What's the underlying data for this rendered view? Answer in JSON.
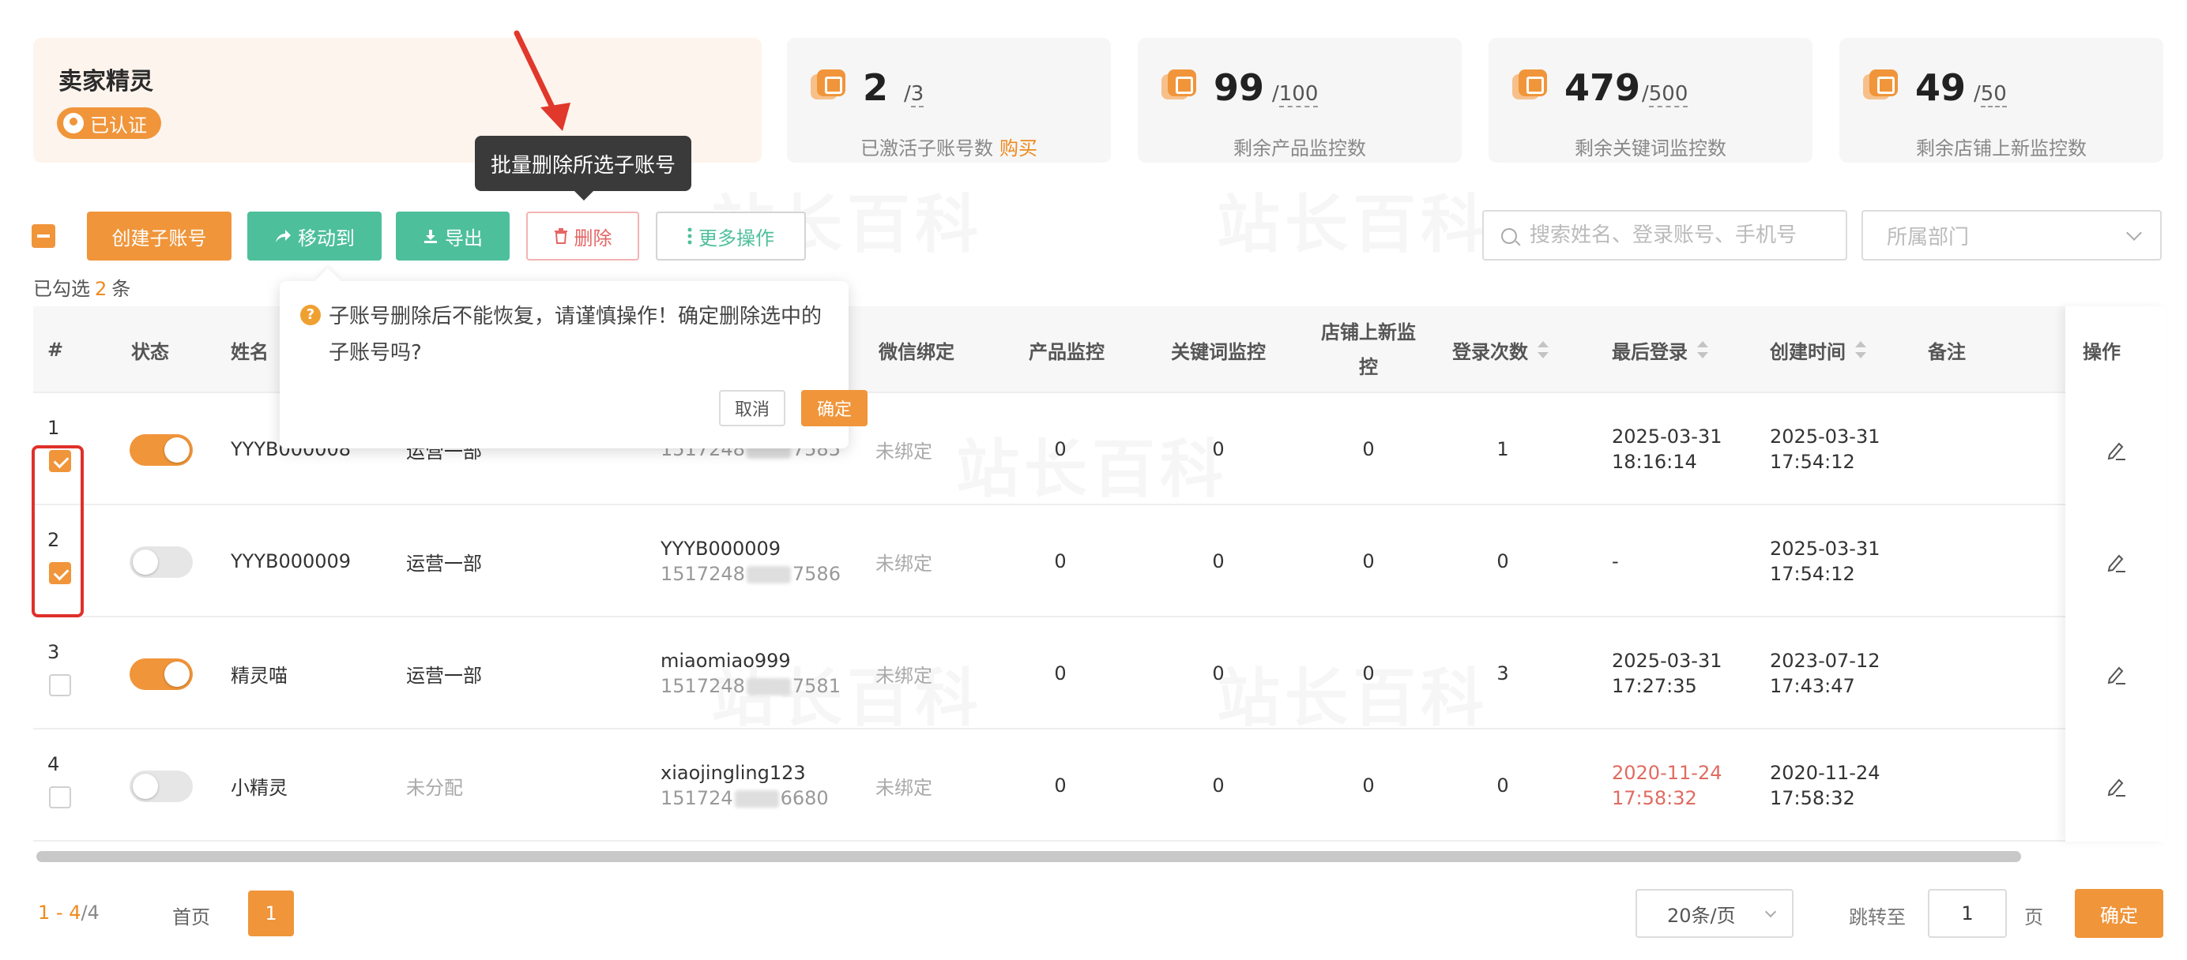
{
  "brand": {
    "name": "卖家精灵",
    "badge": "已认证"
  },
  "stats": [
    {
      "value": "2",
      "total": "3",
      "label": "已激活子账号数",
      "link": "购买"
    },
    {
      "value": "99",
      "total": "100",
      "label": "剩余产品监控数"
    },
    {
      "value": "479",
      "total": "500",
      "label": "剩余关键词监控数"
    },
    {
      "value": "49",
      "total": "50",
      "label": "剩余店铺上新监控数"
    }
  ],
  "tooltip": "批量删除所选子账号",
  "toolbar": {
    "create": "创建子账号",
    "move": "移动到",
    "export": "导出",
    "delete": "删除",
    "more": "更多操作",
    "search_placeholder": "搜索姓名、登录账号、手机号",
    "dept_placeholder": "所属部门"
  },
  "selection": {
    "prefix": "已勾选",
    "count": "2",
    "suffix": "条"
  },
  "columns": {
    "index": "#",
    "status": "状态",
    "name": "姓名",
    "wechat": "微信绑定",
    "product": "产品监控",
    "keyword": "关键词监控",
    "store": "店铺上新监控",
    "logins": "登录次数",
    "last_login": "最后登录",
    "created": "创建时间",
    "note": "备注",
    "action": "操作"
  },
  "rows": [
    {
      "index": "1",
      "checked": true,
      "enabled": true,
      "name": "YYYB000008",
      "dept": "运营一部",
      "account": "",
      "phone_pre": "1517248",
      "phone_suf": "7585",
      "wechat": "未绑定",
      "product": "0",
      "keyword": "0",
      "store": "0",
      "logins": "1",
      "last_login_d": "2025-03-31",
      "last_login_t": "18:16:14",
      "created_d": "2025-03-31",
      "created_t": "17:54:12",
      "note": ""
    },
    {
      "index": "2",
      "checked": true,
      "enabled": false,
      "name": "YYYB000009",
      "dept": "运营一部",
      "account": "YYYB000009",
      "phone_pre": "1517248",
      "phone_suf": "7586",
      "wechat": "未绑定",
      "product": "0",
      "keyword": "0",
      "store": "0",
      "logins": "0",
      "last_login_d": "-",
      "last_login_t": "",
      "created_d": "2025-03-31",
      "created_t": "17:54:12",
      "note": ""
    },
    {
      "index": "3",
      "checked": false,
      "enabled": true,
      "name": "精灵喵",
      "dept": "运营一部",
      "account": "miaomiao999",
      "phone_pre": "1517248",
      "phone_suf": "7581",
      "wechat": "未绑定",
      "product": "0",
      "keyword": "0",
      "store": "0",
      "logins": "3",
      "last_login_d": "2025-03-31",
      "last_login_t": "17:27:35",
      "created_d": "2023-07-12",
      "created_t": "17:43:47",
      "note": ""
    },
    {
      "index": "4",
      "checked": false,
      "enabled": false,
      "name": "小精灵",
      "dept": "未分配",
      "account": "xiaojingling123",
      "phone_pre": "151724",
      "phone_suf": "6680",
      "wechat": "未绑定",
      "product": "0",
      "keyword": "0",
      "store": "0",
      "logins": "0",
      "last_login_d": "2020-11-24",
      "last_login_t": "17:58:32",
      "created_d": "2020-11-24",
      "created_t": "17:58:32",
      "note": ""
    }
  ],
  "popconfirm": {
    "message": "子账号删除后不能恢复，请谨慎操作！确定删除选中的子账号吗?",
    "cancel": "取消",
    "ok": "确定"
  },
  "pagination": {
    "range": "1 - 4",
    "total": "/4",
    "first": "首页",
    "current": "1",
    "page_size": "20条/页",
    "jump_label": "跳转至",
    "jump_value": "1",
    "page_unit": "页",
    "confirm": "确定"
  },
  "watermark": "站长百科",
  "colors": {
    "accent": "#f0953a",
    "green": "#4dbf9a",
    "danger": "#e56565",
    "highlight": "#e0302a"
  }
}
